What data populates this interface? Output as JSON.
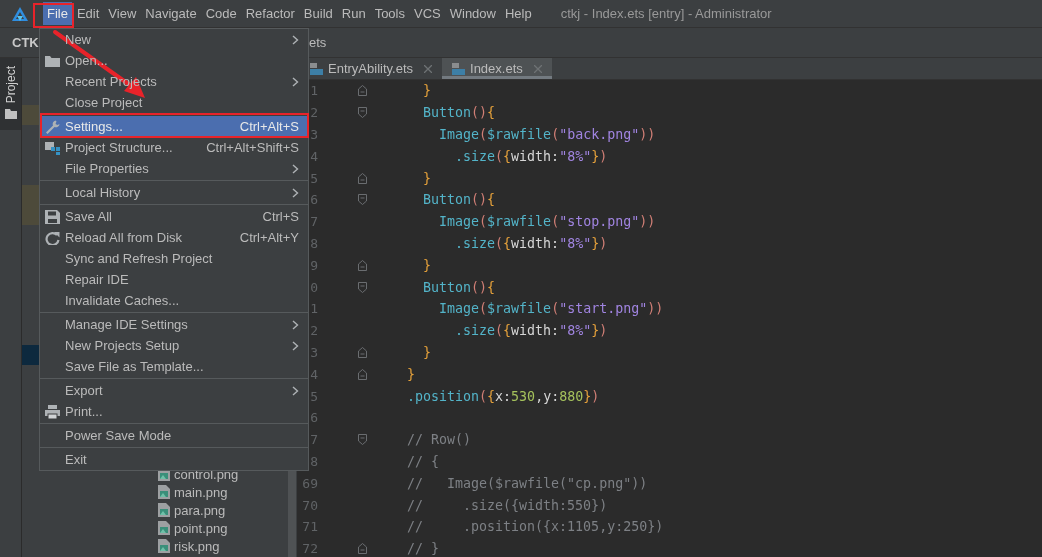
{
  "menubar": {
    "items": [
      {
        "label": "File",
        "selected": true
      },
      {
        "label": "Edit",
        "selected": false
      },
      {
        "label": "View",
        "selected": false
      },
      {
        "label": "Navigate",
        "selected": false
      },
      {
        "label": "Code",
        "selected": false
      },
      {
        "label": "Refactor",
        "selected": false
      },
      {
        "label": "Build",
        "selected": false
      },
      {
        "label": "Run",
        "selected": false
      },
      {
        "label": "Tools",
        "selected": false
      },
      {
        "label": "VCS",
        "selected": false
      },
      {
        "label": "Window",
        "selected": false
      },
      {
        "label": "Help",
        "selected": false
      }
    ],
    "title": "ctkj - Index.ets [entry] - Administrator"
  },
  "toolbar": {
    "project_name": "CTK",
    "breadcrumb": "ets"
  },
  "tool_strip": {
    "tab": "Project"
  },
  "project_panel": {
    "files": [
      {
        "label": "control.png"
      },
      {
        "label": "main.png"
      },
      {
        "label": "para.png"
      },
      {
        "label": "point.png"
      },
      {
        "label": "risk.png"
      }
    ]
  },
  "editor": {
    "tabs": [
      {
        "label": "EntryAbility.ets",
        "selected": false
      },
      {
        "label": "Index.ets",
        "selected": true
      }
    ],
    "lines": [
      {
        "number": "1",
        "fold_start": false,
        "fold_end": true,
        "code": [
          {
            "text": "  }",
            "kind": "brace"
          }
        ]
      },
      {
        "number": "2",
        "fold_start": true,
        "fold_end": false,
        "code": [
          {
            "text": "  Button",
            "kind": "fn"
          },
          {
            "text": "()",
            "kind": "paren"
          },
          {
            "text": "{",
            "kind": "brace"
          }
        ]
      },
      {
        "number": "3",
        "fold_start": false,
        "fold_end": false,
        "code": [
          {
            "text": "    Image",
            "kind": "fn"
          },
          {
            "text": "(",
            "kind": "paren"
          },
          {
            "text": "$rawfile",
            "kind": "fn"
          },
          {
            "text": "(",
            "kind": "paren"
          },
          {
            "text": "\"back.png\"",
            "kind": "string"
          },
          {
            "text": "))",
            "kind": "paren"
          }
        ]
      },
      {
        "number": "4",
        "fold_start": false,
        "fold_end": false,
        "code": [
          {
            "text": "      .size",
            "kind": "fn"
          },
          {
            "text": "(",
            "kind": "paren"
          },
          {
            "text": "{",
            "kind": "brace"
          },
          {
            "text": "width:",
            "kind": "plain"
          },
          {
            "text": "\"8%\"",
            "kind": "string"
          },
          {
            "text": "}",
            "kind": "brace"
          },
          {
            "text": ")",
            "kind": "paren"
          }
        ]
      },
      {
        "number": "5",
        "fold_start": false,
        "fold_end": true,
        "code": [
          {
            "text": "  }",
            "kind": "brace"
          }
        ]
      },
      {
        "number": "6",
        "fold_start": true,
        "fold_end": false,
        "code": [
          {
            "text": "  Button",
            "kind": "fn"
          },
          {
            "text": "()",
            "kind": "paren"
          },
          {
            "text": "{",
            "kind": "brace"
          }
        ]
      },
      {
        "number": "7",
        "fold_start": false,
        "fold_end": false,
        "code": [
          {
            "text": "    Image",
            "kind": "fn"
          },
          {
            "text": "(",
            "kind": "paren"
          },
          {
            "text": "$rawfile",
            "kind": "fn"
          },
          {
            "text": "(",
            "kind": "paren"
          },
          {
            "text": "\"stop.png\"",
            "kind": "string"
          },
          {
            "text": "))",
            "kind": "paren"
          }
        ]
      },
      {
        "number": "8",
        "fold_start": false,
        "fold_end": false,
        "code": [
          {
            "text": "      .size",
            "kind": "fn"
          },
          {
            "text": "(",
            "kind": "paren"
          },
          {
            "text": "{",
            "kind": "brace"
          },
          {
            "text": "width:",
            "kind": "plain"
          },
          {
            "text": "\"8%\"",
            "kind": "string"
          },
          {
            "text": "}",
            "kind": "brace"
          },
          {
            "text": ")",
            "kind": "paren"
          }
        ]
      },
      {
        "number": "9",
        "fold_start": false,
        "fold_end": true,
        "code": [
          {
            "text": "  }",
            "kind": "brace"
          }
        ]
      },
      {
        "number": "0",
        "fold_start": true,
        "fold_end": false,
        "code": [
          {
            "text": "  Button",
            "kind": "fn"
          },
          {
            "text": "()",
            "kind": "paren"
          },
          {
            "text": "{",
            "kind": "brace"
          }
        ]
      },
      {
        "number": "1",
        "fold_start": false,
        "fold_end": false,
        "code": [
          {
            "text": "    Image",
            "kind": "fn"
          },
          {
            "text": "(",
            "kind": "paren"
          },
          {
            "text": "$rawfile",
            "kind": "fn"
          },
          {
            "text": "(",
            "kind": "paren"
          },
          {
            "text": "\"start.png\"",
            "kind": "string"
          },
          {
            "text": "))",
            "kind": "paren"
          }
        ]
      },
      {
        "number": "2",
        "fold_start": false,
        "fold_end": false,
        "code": [
          {
            "text": "      .size",
            "kind": "fn"
          },
          {
            "text": "(",
            "kind": "paren"
          },
          {
            "text": "{",
            "kind": "brace"
          },
          {
            "text": "width:",
            "kind": "plain"
          },
          {
            "text": "\"8%\"",
            "kind": "string"
          },
          {
            "text": "}",
            "kind": "brace"
          },
          {
            "text": ")",
            "kind": "paren"
          }
        ]
      },
      {
        "number": "3",
        "fold_start": false,
        "fold_end": true,
        "code": [
          {
            "text": "  }",
            "kind": "brace"
          }
        ]
      },
      {
        "number": "4",
        "fold_start": false,
        "fold_end": true,
        "code": [
          {
            "text": "}",
            "kind": "brace"
          }
        ]
      },
      {
        "number": "5",
        "fold_start": false,
        "fold_end": false,
        "code": [
          {
            "text": ".position",
            "kind": "fn"
          },
          {
            "text": "(",
            "kind": "paren"
          },
          {
            "text": "{",
            "kind": "brace"
          },
          {
            "text": "x:",
            "kind": "plain"
          },
          {
            "text": "530",
            "kind": "num"
          },
          {
            "text": ",y:",
            "kind": "plain"
          },
          {
            "text": "880",
            "kind": "num"
          },
          {
            "text": "}",
            "kind": "brace"
          },
          {
            "text": ")",
            "kind": "paren"
          }
        ]
      },
      {
        "number": "6",
        "fold_start": false,
        "fold_end": false
      },
      {
        "number": "7",
        "fold_start": true,
        "fold_end": false,
        "code": [
          {
            "text": "// Row()",
            "kind": "comment"
          }
        ]
      },
      {
        "number": "8",
        "fold_start": false,
        "fold_end": false,
        "code": [
          {
            "text": "// {",
            "kind": "comment"
          }
        ]
      },
      {
        "number": "69",
        "fold_start": false,
        "fold_end": false,
        "code": [
          {
            "text": "//   Image($rawfile(\"cp.png\"))",
            "kind": "comment"
          }
        ]
      },
      {
        "number": "70",
        "fold_start": false,
        "fold_end": false,
        "code": [
          {
            "text": "//     .size({width:550})",
            "kind": "comment"
          }
        ]
      },
      {
        "number": "71",
        "fold_start": false,
        "fold_end": false,
        "code": [
          {
            "text": "//     .position({x:1105,y:250})",
            "kind": "comment"
          }
        ]
      },
      {
        "number": "72",
        "fold_start": false,
        "fold_end": true,
        "code": [
          {
            "text": "// }",
            "kind": "comment"
          }
        ]
      }
    ]
  },
  "file_menu": {
    "items": [
      {
        "kind": "item",
        "label": "New",
        "submenu": true,
        "selected": false
      },
      {
        "kind": "item",
        "label": "Open...",
        "selected": false
      },
      {
        "kind": "item",
        "label": "Recent Projects",
        "submenu": true,
        "selected": false
      },
      {
        "kind": "item",
        "label": "Close Project",
        "selected": false
      },
      {
        "kind": "separator"
      },
      {
        "kind": "item",
        "label": "Settings...",
        "shortcut": "Ctrl+Alt+S",
        "selected": true
      },
      {
        "kind": "item",
        "label": "Project Structure...",
        "shortcut": "Ctrl+Alt+Shift+S",
        "selected": false
      },
      {
        "kind": "item",
        "label": "File Properties",
        "submenu": true,
        "selected": false
      },
      {
        "kind": "separator"
      },
      {
        "kind": "item",
        "label": "Local History",
        "submenu": true,
        "selected": false
      },
      {
        "kind": "separator"
      },
      {
        "kind": "item",
        "label": "Save All",
        "shortcut": "Ctrl+S",
        "selected": false
      },
      {
        "kind": "item",
        "label": "Reload All from Disk",
        "shortcut": "Ctrl+Alt+Y",
        "selected": false
      },
      {
        "kind": "item",
        "label": "Sync and Refresh Project",
        "selected": false
      },
      {
        "kind": "item",
        "label": "Repair IDE",
        "selected": false
      },
      {
        "kind": "item",
        "label": "Invalidate Caches...",
        "selected": false
      },
      {
        "kind": "separator"
      },
      {
        "kind": "item",
        "label": "Manage IDE Settings",
        "submenu": true,
        "selected": false
      },
      {
        "kind": "item",
        "label": "New Projects Setup",
        "submenu": true,
        "selected": false
      },
      {
        "kind": "item",
        "label": "Save File as Template...",
        "selected": false
      },
      {
        "kind": "separator"
      },
      {
        "kind": "item",
        "label": "Export",
        "submenu": true,
        "selected": false
      },
      {
        "kind": "item",
        "label": "Print...",
        "selected": false
      },
      {
        "kind": "separator"
      },
      {
        "kind": "item",
        "label": "Power Save Mode",
        "selected": false
      },
      {
        "kind": "separator"
      },
      {
        "kind": "item",
        "label": "Exit",
        "selected": false
      }
    ]
  }
}
